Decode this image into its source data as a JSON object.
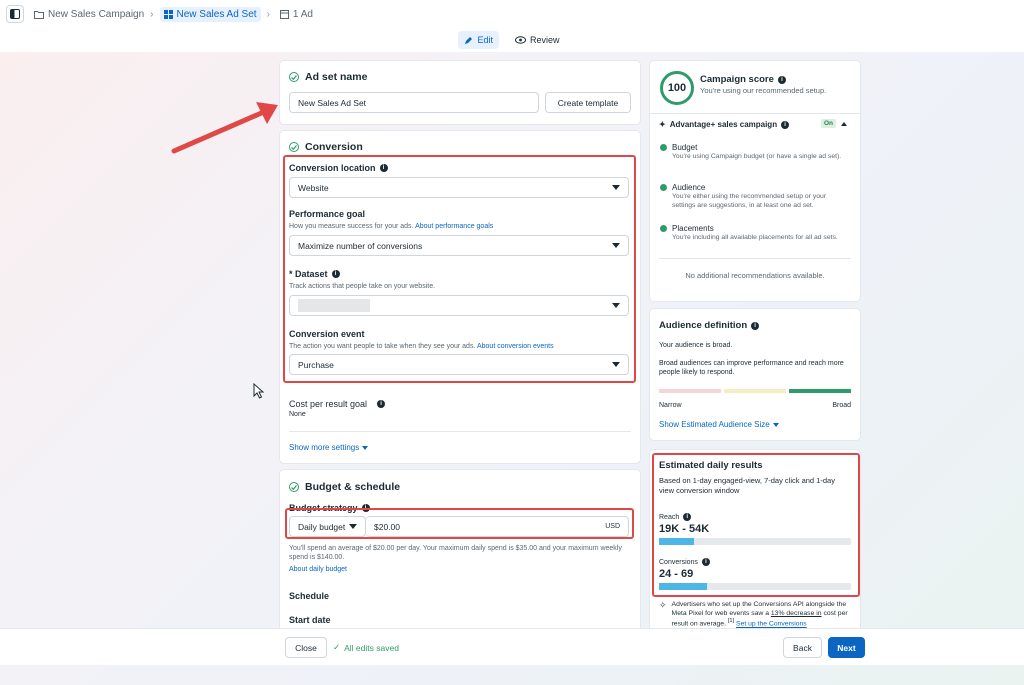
{
  "breadcrumb": {
    "campaign": "New Sales Campaign",
    "adset": "New Sales Ad Set",
    "ad": "1 Ad"
  },
  "modes": {
    "edit": "Edit",
    "review": "Review"
  },
  "adset_name": {
    "title": "Ad set name",
    "value": "New Sales Ad Set",
    "create_template": "Create template"
  },
  "conversion": {
    "title": "Conversion",
    "location_label": "Conversion location",
    "location_value": "Website",
    "goal_label": "Performance goal",
    "goal_help": "How you measure success for your ads.",
    "goal_help_link": "About performance goals",
    "goal_value": "Maximize number of conversions",
    "dataset_label": "* Dataset",
    "dataset_help": "Track actions that people take on your website.",
    "event_label": "Conversion event",
    "event_help": "The action you want people to take when they see your ads.",
    "event_help_link": "About conversion events",
    "event_value": "Purchase",
    "cost_label": "Cost per result goal",
    "cost_value": "None",
    "show_more": "Show more settings"
  },
  "budget": {
    "title": "Budget & schedule",
    "strategy_label": "Budget strategy",
    "type_value": "Daily budget",
    "amount_value": "$20.00",
    "currency": "USD",
    "note": "You'll spend an average of $20.00 per day. Your maximum daily spend is $35.00 and your maximum weekly spend is $140.00.",
    "about_link": "About daily budget",
    "schedule_label": "Schedule",
    "start_label": "Start date"
  },
  "score": {
    "value": "100",
    "title": "Campaign score",
    "subtitle": "You're using our recommended setup.",
    "advantage_label": "Advantage+ sales campaign",
    "advantage_state": "On",
    "items": [
      {
        "title": "Budget",
        "desc": "You're using Campaign budget (or have a single ad set)."
      },
      {
        "title": "Audience",
        "desc": "You're either using the recommended setup or your settings are suggestions, in at least one ad set."
      },
      {
        "title": "Placements",
        "desc": "You're including all available placements for all ad sets."
      }
    ],
    "no_recs": "No additional recommendations available."
  },
  "audience": {
    "title": "Audience definition",
    "status": "Your audience is broad.",
    "desc": "Broad audiences can improve performance and reach more people likely to respond.",
    "narrow": "Narrow",
    "broad": "Broad",
    "show_size": "Show Estimated Audience Size"
  },
  "estimates": {
    "title": "Estimated daily results",
    "desc": "Based on 1-day engaged-view, 7-day click and 1-day view conversion window",
    "reach_label": "Reach",
    "reach_value": "19K - 54K",
    "reach_level": 0.18,
    "conv_label": "Conversions",
    "conv_value": "24 - 69",
    "conv_level": 0.25,
    "tip_text": "Advertisers who set up the Conversions API alongside the Meta Pixel for web events saw a",
    "tip_link": "13% decrease in",
    "tip_text2": "cost per result on average.",
    "tip_sup": "[1]",
    "tip_link2": "Set up the Conversions"
  },
  "footer": {
    "close": "Close",
    "saved": "All edits saved",
    "back": "Back",
    "next": "Next"
  },
  "colors": {
    "accent": "#0a66c2",
    "annotation": "#e04848",
    "success": "#2e9c6a"
  }
}
